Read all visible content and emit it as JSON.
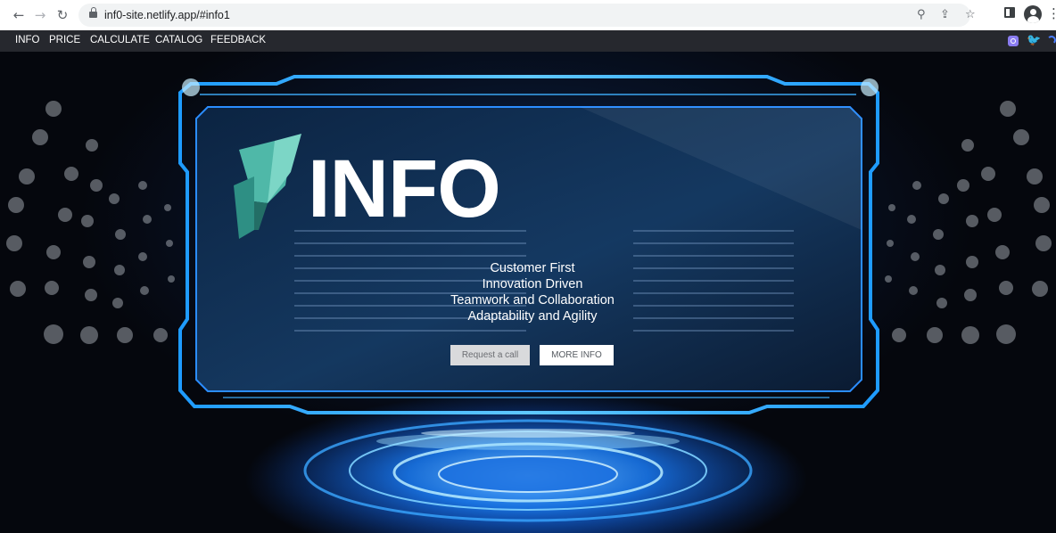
{
  "browser": {
    "url": "inf0-site.netlify.app/#info1"
  },
  "nav": {
    "items": [
      "INFO",
      "PRICE",
      "CALCULATE",
      "CATALOG",
      "FEEDBACK"
    ]
  },
  "social": [
    "instagram-icon",
    "twitter-icon",
    "edge-icon"
  ],
  "hero": {
    "title": "INFO",
    "taglines": [
      "Customer First",
      "Innovation Driven",
      "Teamwork and Collaboration",
      "Adaptability and Agility"
    ],
    "buttons": {
      "call": "Request a call",
      "more": "MORE INFO"
    }
  },
  "colors": {
    "nav_bg": "#26282e",
    "accent_blue": "#1d7cff",
    "logo_teal": "#4fb8a8"
  }
}
